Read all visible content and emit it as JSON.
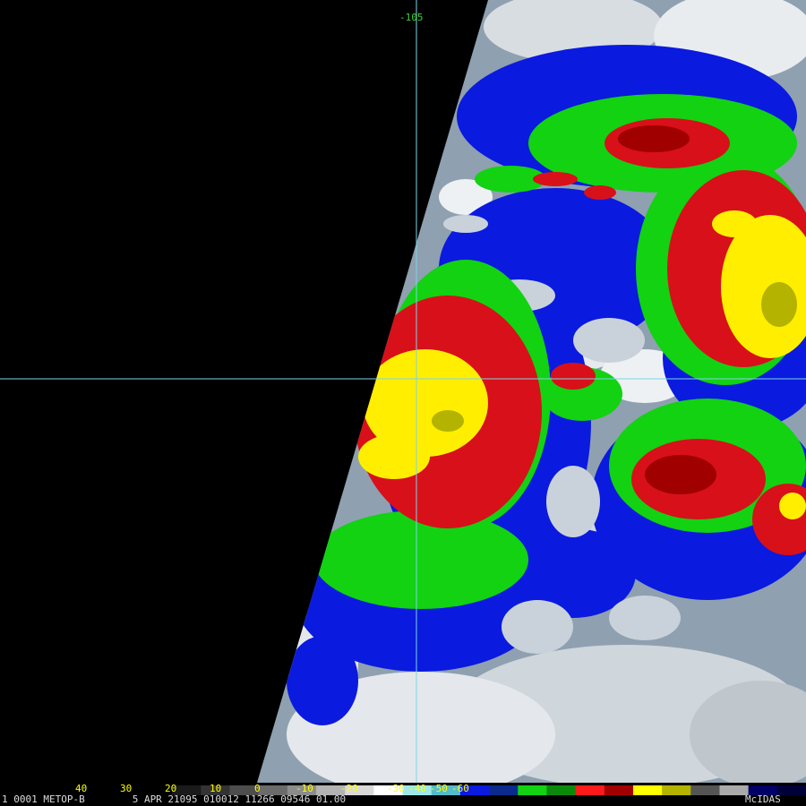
{
  "colors": {
    "background": "#000000",
    "gridline": "#7fd4e6",
    "lon_label": "#3cd23c",
    "scale_text": "#ffff00",
    "footer_text": "#dcdcdc"
  },
  "map": {
    "gridline_longitude_label": "-105"
  },
  "scale": {
    "labels": [
      "40",
      "30",
      "20",
      "10",
      "0",
      "-10",
      "-20",
      "-30",
      "-40",
      "-50",
      "-60"
    ],
    "colors": [
      "#000000",
      "#1a1a1a",
      "#333333",
      "#4d4d4d",
      "#6b6b6b",
      "#8c8c8c",
      "#b3b3b3",
      "#d9d9d9",
      "#ffffff",
      "#9fe8e8",
      "#55bbcc",
      "#0a1adf",
      "#0a2a8c",
      "#12d212",
      "#0a8a0a",
      "#ff1a1a",
      "#a00000",
      "#ffff00",
      "#b3b300",
      "#555555",
      "#aaaaaa",
      "#000066",
      "#00003a"
    ]
  },
  "footer": {
    "text": "1 0001 METOP-B        5 APR 21095 010012 11266 09546 01.00",
    "brand": "McIDAS"
  }
}
